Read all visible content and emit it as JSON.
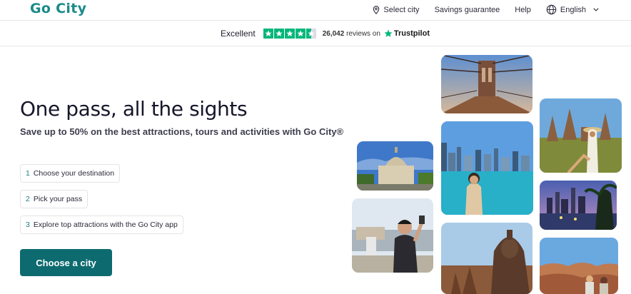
{
  "header": {
    "logo": "Go City",
    "nav": {
      "select_city": "Select city",
      "savings": "Savings guarantee",
      "help": "Help",
      "language": "English"
    }
  },
  "trust": {
    "rating_word": "Excellent",
    "stars": 4.5,
    "reviews_count": "26,042",
    "reviews_suffix": "reviews on",
    "brand": "Trustpilot",
    "brand_color": "#00b67a"
  },
  "hero": {
    "title": "One pass, all the sights",
    "subtitle": "Save up to 50% on the best attractions, tours and activities with Go City®",
    "steps": [
      {
        "num": "1",
        "text": "Choose your destination"
      },
      {
        "num": "2",
        "text": "Pick your pass"
      },
      {
        "num": "3",
        "text": "Explore top attractions with the Go City app"
      }
    ],
    "cta": "Choose a city"
  },
  "colors": {
    "brand_teal": "#1a8a8a",
    "cta_bg": "#0d6b70"
  },
  "photos": [
    {
      "subject": "bridge"
    },
    {
      "subject": "temple ruins"
    },
    {
      "subject": "dome building"
    },
    {
      "subject": "city skyline lake"
    },
    {
      "subject": "traveler selfie"
    },
    {
      "subject": "city night waterfront"
    },
    {
      "subject": "buddha statue"
    },
    {
      "subject": "canyon view"
    }
  ]
}
